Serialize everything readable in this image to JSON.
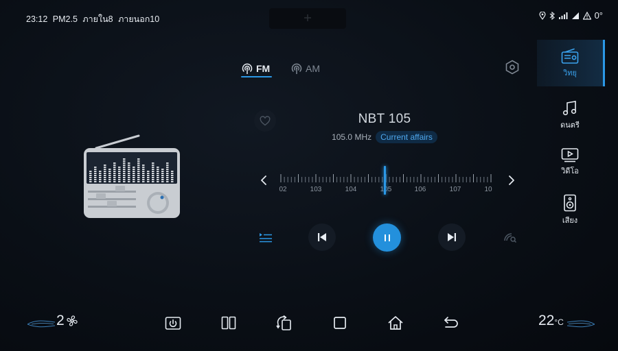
{
  "status_bar": {
    "time": "23:12",
    "air_quality": "PM2.5",
    "inside": "ภายใน8",
    "outside": "ภายนอก10",
    "outside_temp": "0°"
  },
  "tabs": [
    {
      "label": "FM",
      "active": true
    },
    {
      "label": "AM",
      "active": false
    }
  ],
  "station": {
    "name": "NBT 105",
    "frequency": "105.0 MHz",
    "category": "Current affairs"
  },
  "tuner": {
    "current_mhz": 105.0,
    "labels": [
      "02",
      "103",
      "104",
      "105",
      "106",
      "107",
      "10"
    ]
  },
  "player": {
    "state": "playing"
  },
  "sidebar": {
    "items": [
      {
        "label": "วิทยุ",
        "icon": "radio-icon",
        "active": true
      },
      {
        "label": "ดนตรี",
        "icon": "music-note-icon",
        "active": false
      },
      {
        "label": "วิดีโอ",
        "icon": "video-icon",
        "active": false
      },
      {
        "label": "เสียง",
        "icon": "speaker-icon",
        "active": false
      }
    ]
  },
  "dock": {
    "fan_level": "2",
    "temperature": "22",
    "temperature_unit": "°C"
  },
  "colors": {
    "accent": "#2b98e6",
    "background": "#0a0f16",
    "inactive_text": "#7f8893"
  }
}
